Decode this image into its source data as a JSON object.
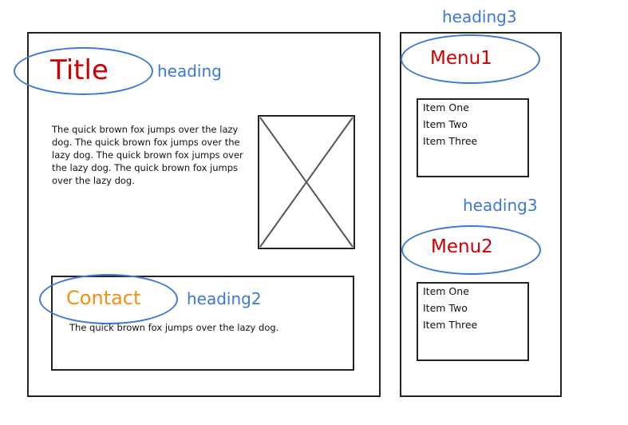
{
  "main": {
    "title": "Title",
    "title_annotation": "heading",
    "paragraph": "The quick brown fox jumps over the lazy dog. The quick brown fox jumps over the lazy dog. The quick brown fox jumps over the lazy dog. The quick brown fox jumps over the lazy dog.",
    "contact": {
      "heading": "Contact",
      "annotation": "heading2",
      "text": "The quick brown fox jumps over the lazy dog."
    }
  },
  "sidebar": {
    "menus": [
      {
        "annotation": "heading3",
        "heading": "Menu1",
        "items": [
          "Item One",
          "Item Two",
          "Item Three"
        ]
      },
      {
        "annotation": "heading3",
        "heading": "Menu2",
        "items": [
          "Item One",
          "Item Two",
          "Item Three"
        ]
      }
    ]
  },
  "colors": {
    "annotation": "#3b78d8",
    "heading_red": "#cc0000",
    "heading_orange": "#f29111",
    "outline": "#222222"
  }
}
